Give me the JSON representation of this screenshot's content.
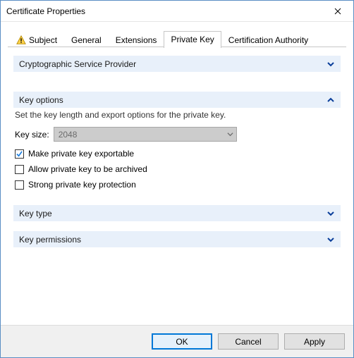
{
  "window": {
    "title": "Certificate Properties"
  },
  "tabs": {
    "subject": "Subject",
    "general": "General",
    "extensions": "Extensions",
    "private_key": "Private Key",
    "cert_authority": "Certification Authority"
  },
  "sections": {
    "csp": {
      "title": "Cryptographic Service Provider"
    },
    "key_options": {
      "title": "Key options",
      "description": "Set the key length and export options for the private key.",
      "key_size_label": "Key size:",
      "key_size_value": "2048",
      "chk_exportable": "Make private key exportable",
      "chk_archived": "Allow private key to be archived",
      "chk_strong": "Strong private key protection"
    },
    "key_type": {
      "title": "Key type"
    },
    "key_permissions": {
      "title": "Key permissions"
    }
  },
  "buttons": {
    "ok": "OK",
    "cancel": "Cancel",
    "apply": "Apply"
  }
}
